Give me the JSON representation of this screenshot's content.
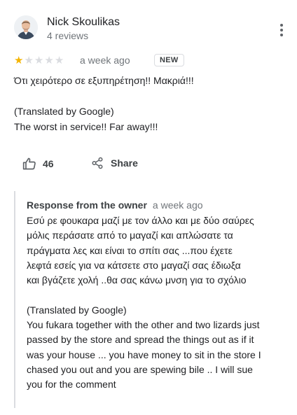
{
  "reviewer": {
    "name": "Nick Skoulikas",
    "subtitle": "4 reviews",
    "avatar_icon": "person-avatar",
    "menu_icon": "more-vert-icon"
  },
  "rating": {
    "stars": 1,
    "max_stars": 5,
    "time": "a week ago",
    "badge": "NEW",
    "star_color": "#f4b400"
  },
  "review": {
    "text_lines": [
      "Ότι χειρότερο σε εξυπηρέτηση!! Μακριά!!!",
      "",
      "(Translated by Google)",
      "The worst in service!! Far away!!!"
    ]
  },
  "actions": {
    "like_icon": "thumb-up-icon",
    "like_count": "46",
    "share_icon": "share-icon",
    "share_label": "Share"
  },
  "owner_response": {
    "label": "Response from the owner",
    "time": "a week ago",
    "text_lines": [
      "Εσύ  ρε φουκαρα μαζί με τον άλλο και με δύο σαύρες",
      "μόλις περάσατε από το μαγαζί και απλώσατε  τα",
      "πράγματα λες και είναι το σπίτι σας ...που έχετε",
      "λεφτά εσείς για να κάτσετε στο μαγαζί  σας έδιωξα",
      "και βγάζετε χολή  ..θα σας κάνω μνση για το σχόλιο",
      "",
      "(Translated by Google)",
      "You fukara together with the other and two lizards just",
      "passed by the store and spread the things out as if it",
      "was your house ... you have money to sit in the store I",
      "chased you out and you are spewing bile .. I will sue",
      "you for the comment"
    ]
  }
}
